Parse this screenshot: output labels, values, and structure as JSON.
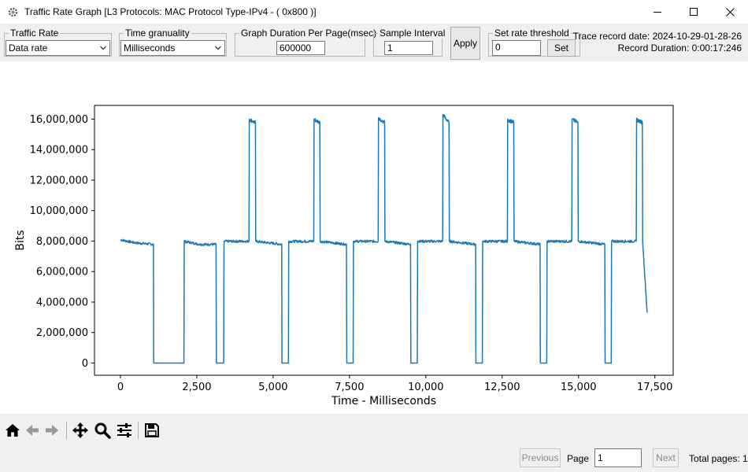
{
  "window": {
    "title": "Traffic Rate Graph [L3 Protocols:  MAC Protocol Type-IPv4 - ( 0x800 )]",
    "minimize_icon": "minimize-icon",
    "maximize_icon": "maximize-icon",
    "close_icon": "close-icon"
  },
  "controls": {
    "traffic_rate": {
      "label": "Traffic Rate",
      "value": "Data rate"
    },
    "time_granularity": {
      "label": "Time granuality",
      "value": "Milliseconds"
    },
    "graph_duration": {
      "label": "Graph Duration Per Page(msec)",
      "value": "600000"
    },
    "sample_interval": {
      "label": "Sample Interval",
      "value": "1"
    },
    "apply_label": "Apply",
    "threshold": {
      "label": "Set rate threshold",
      "value": "0",
      "set_label": "Set"
    },
    "trace_record_date": "Trace record date: 2024-10-29-01-28-26",
    "record_duration": "Record Duration: 0:00:17:246"
  },
  "navigation_toolbar": [
    "home-icon",
    "back-arrow-icon",
    "forward-arrow-icon",
    "pan-icon",
    "zoom-icon",
    "configure-subplots-icon",
    "save-icon"
  ],
  "pager": {
    "previous_label": "Previous",
    "page_label": "Page",
    "page_value": "1",
    "next_label": "Next",
    "total_pages": "Total pages: 1"
  },
  "chart_data": {
    "type": "line",
    "xlabel": "Time - Milliseconds",
    "ylabel": "Bits",
    "xlim": [
      -850,
      18100
    ],
    "ylim": [
      -800000,
      16900000
    ],
    "x_ticks": [
      0,
      2500,
      5000,
      7500,
      10000,
      12500,
      15000,
      17500
    ],
    "x_tick_labels": [
      "0",
      "2,500",
      "5,000",
      "7,500",
      "10,000",
      "12,500",
      "15,000",
      "17,500"
    ],
    "y_ticks": [
      0,
      2000000,
      4000000,
      6000000,
      8000000,
      10000000,
      12000000,
      14000000,
      16000000
    ],
    "y_tick_labels": [
      "0",
      "2,000,000",
      "4,000,000",
      "6,000,000",
      "8,000,000",
      "10,000,000",
      "12,000,000",
      "14,000,000",
      "16,000,000"
    ],
    "line_color": "#1f77b4",
    "series": [
      {
        "values": [
          [
            0,
            8100000
          ],
          [
            500,
            7900000
          ],
          [
            1080,
            7800000
          ],
          [
            1090,
            0
          ],
          [
            2080,
            0
          ],
          [
            2090,
            8000000
          ],
          [
            2600,
            7800000
          ],
          [
            3130,
            7800000
          ],
          [
            3140,
            0
          ],
          [
            3380,
            0
          ],
          [
            3390,
            8000000
          ],
          [
            4210,
            8000000
          ],
          [
            4220,
            16000000
          ],
          [
            4420,
            15800000
          ],
          [
            4430,
            8000000
          ],
          [
            5280,
            7800000
          ],
          [
            5290,
            0
          ],
          [
            5500,
            0
          ],
          [
            5510,
            8000000
          ],
          [
            6330,
            8000000
          ],
          [
            6340,
            16000000
          ],
          [
            6530,
            15800000
          ],
          [
            6540,
            8000000
          ],
          [
            7400,
            7800000
          ],
          [
            7410,
            0
          ],
          [
            7620,
            0
          ],
          [
            7630,
            8000000
          ],
          [
            8440,
            8000000
          ],
          [
            8450,
            16100000
          ],
          [
            8650,
            15800000
          ],
          [
            8660,
            8000000
          ],
          [
            9500,
            7800000
          ],
          [
            9510,
            0
          ],
          [
            9720,
            0
          ],
          [
            9730,
            8000000
          ],
          [
            10550,
            8000000
          ],
          [
            10560,
            16300000
          ],
          [
            10760,
            15800000
          ],
          [
            10770,
            8000000
          ],
          [
            11630,
            7800000
          ],
          [
            11640,
            0
          ],
          [
            11850,
            0
          ],
          [
            11860,
            8000000
          ],
          [
            12670,
            8000000
          ],
          [
            12680,
            16000000
          ],
          [
            12880,
            15800000
          ],
          [
            12890,
            8000000
          ],
          [
            13740,
            7800000
          ],
          [
            13750,
            0
          ],
          [
            13960,
            0
          ],
          [
            13970,
            8000000
          ],
          [
            14780,
            8000000
          ],
          [
            14790,
            16000000
          ],
          [
            14980,
            15800000
          ],
          [
            14990,
            8000000
          ],
          [
            15860,
            7800000
          ],
          [
            15870,
            0
          ],
          [
            16070,
            0
          ],
          [
            16080,
            8000000
          ],
          [
            16890,
            8000000
          ],
          [
            16900,
            16000000
          ],
          [
            17090,
            15800000
          ],
          [
            17100,
            8000000
          ],
          [
            17246,
            3300000
          ]
        ]
      }
    ]
  }
}
